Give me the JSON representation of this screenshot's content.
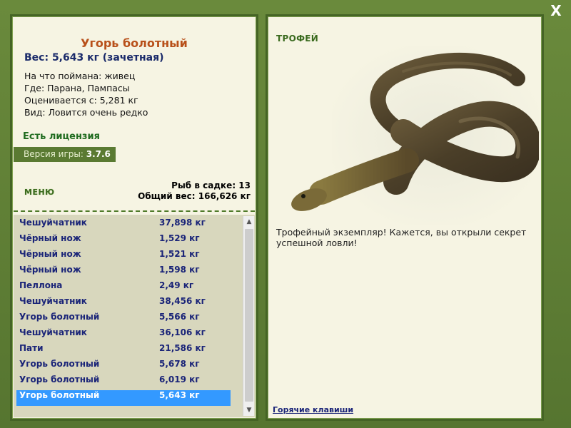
{
  "window": {
    "close_label": "X"
  },
  "fish": {
    "title": "Угорь болотный",
    "weight_line": "Вес: 5,643 кг (зачетная)",
    "caught_on": "На что поймана: живец",
    "where": "Где: Парана, Пампасы",
    "valued_from": "Оценивается с: 5,281 кг",
    "rarity": "Вид: Ловится очень редко"
  },
  "license": "Есть лицензия",
  "version": {
    "label": "Версия игры:",
    "value": "3.7.6"
  },
  "menu_label": "МЕНЮ",
  "keepnet": {
    "fish_count": "Рыб в садке: 13",
    "total_weight": "Общий вес: 166,626 кг"
  },
  "catch_list": [
    {
      "name": "Чешуйчатник",
      "weight": "37,898 кг"
    },
    {
      "name": "Чёрный нож",
      "weight": "1,529 кг"
    },
    {
      "name": "Чёрный нож",
      "weight": "1,521 кг"
    },
    {
      "name": "Чёрный нож",
      "weight": "1,598 кг"
    },
    {
      "name": "Пеллона",
      "weight": "2,49 кг"
    },
    {
      "name": "Чешуйчатник",
      "weight": "38,456 кг"
    },
    {
      "name": "Угорь болотный",
      "weight": "5,566 кг"
    },
    {
      "name": "Чешуйчатник",
      "weight": "36,106 кг"
    },
    {
      "name": "Пати",
      "weight": "21,586 кг"
    },
    {
      "name": "Угорь болотный",
      "weight": "5,678 кг"
    },
    {
      "name": "Угорь болотный",
      "weight": "6,019 кг"
    },
    {
      "name": "Угорь болотный",
      "weight": "5,643 кг",
      "selected": true
    }
  ],
  "trophy": {
    "label": "ТРОФЕЙ",
    "text": "Трофейный экземпляр! Кажется, вы открыли секрет успешной ловли!"
  },
  "hotkeys_link": "Горячие клавиши",
  "colors": {
    "frame": "#5f7f35",
    "panel_bg": "#f6f4e3",
    "title_orange": "#b8501a",
    "navy": "#1a2478",
    "selection": "#3399ff",
    "green_text": "#1f6b1f"
  }
}
